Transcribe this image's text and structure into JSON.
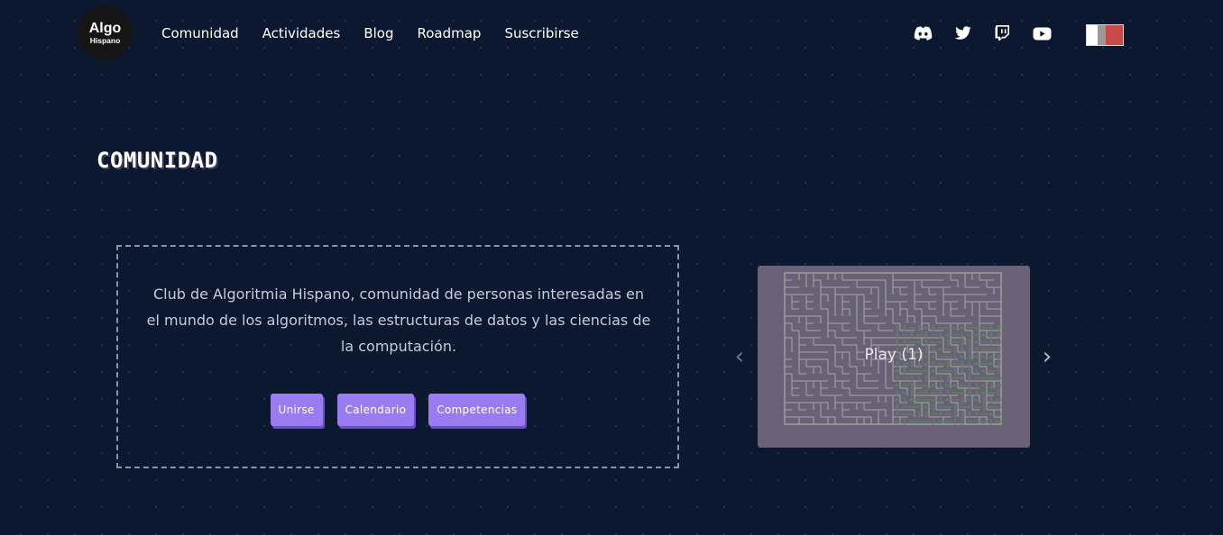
{
  "header": {
    "logo": {
      "line1": "Algo",
      "line2": "Hispano"
    },
    "nav": [
      {
        "label": "Comunidad"
      },
      {
        "label": "Actividades"
      },
      {
        "label": "Blog"
      },
      {
        "label": "Roadmap"
      },
      {
        "label": "Suscribirse"
      }
    ],
    "socials": [
      "discord-icon",
      "twitter-icon",
      "twitch-icon",
      "youtube-icon"
    ],
    "language_flag": "language-flag-icon"
  },
  "section": {
    "title": "COMUNIDAD",
    "description": "Club de Algoritmia Hispano, comunidad de personas interesadas en el mundo de los algoritmos, las estructuras de datos y las ciencias de la computación.",
    "buttons": [
      {
        "label": "Unirse"
      },
      {
        "label": "Calendario"
      },
      {
        "label": "Competencias"
      }
    ]
  },
  "carousel": {
    "play_label": "Play (1)",
    "prev_icon": "chevron-left-icon",
    "next_icon": "chevron-right-icon"
  },
  "colors": {
    "background": "#0c1830",
    "button": "#9b7bf2",
    "maze_panel": "#6a6177",
    "maze_walls": "#9a9a9a",
    "maze_path": "#5a8a5a"
  }
}
